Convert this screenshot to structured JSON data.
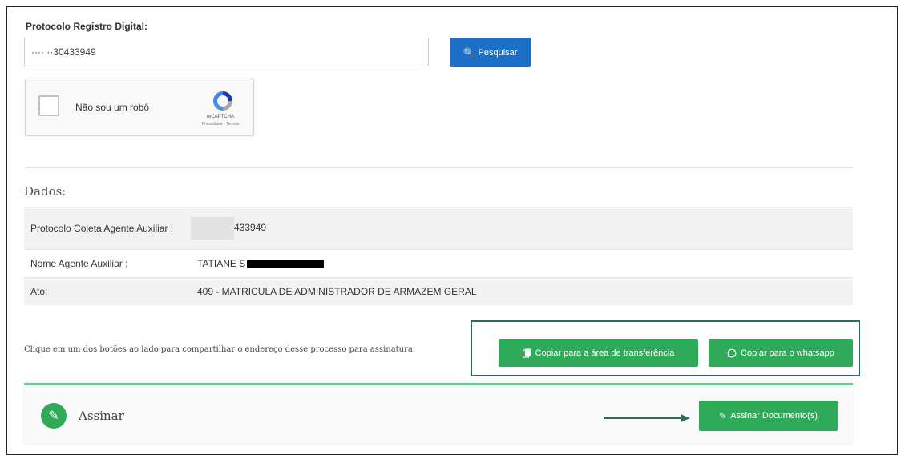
{
  "search": {
    "label": "Protocolo Registro Digital:",
    "value": "···· ··30433949",
    "button_label": "Pesquisar",
    "button_icon": "search-icon",
    "button_color": "#1b6fc6"
  },
  "captcha": {
    "label": "Não sou um robô",
    "brand": "reCAPTCHA",
    "terms": "Privacidade - Termos"
  },
  "dados": {
    "title": "Dados:",
    "rows": [
      {
        "key": "Protocolo Coleta Agente Auxiliar :",
        "value": "433949"
      },
      {
        "key": "Nome Agente Auxiliar :",
        "value": "TATIANE S"
      },
      {
        "key": "Ato:",
        "value": "409 - MATRICULA DE ADMINISTRADOR DE ARMAZEM GERAL"
      }
    ]
  },
  "share": {
    "text": "Clique em um dos botões ao lado para compartilhar o endereço desse processo para assinatura:",
    "clipboard_label": "Copiar para a área de transferência",
    "clipboard_icon": "clipboard-icon",
    "whatsapp_label": "Copiar para o whatsapp",
    "whatsapp_icon": "whatsapp-icon",
    "button_color": "#2eaa59",
    "highlight_color": "#2f6b62"
  },
  "sign": {
    "title": "Assinar",
    "icon": "edit-icon",
    "button_label": "Assinar Documento(s)",
    "button_icon": "edit-icon",
    "accent_color": "#6dca8e"
  }
}
